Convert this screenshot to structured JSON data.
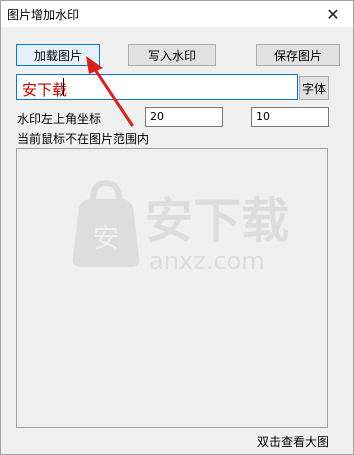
{
  "window": {
    "title": "图片增加水印",
    "close_symbol": "✕"
  },
  "toolbar": {
    "load_label": "加载图片",
    "write_label": "写入水印",
    "save_label": "保存图片"
  },
  "watermark": {
    "text": "安下载",
    "font_button": "字体"
  },
  "coords": {
    "label": "水印左上角坐标",
    "x": "20",
    "y": "10"
  },
  "status": {
    "text": "当前鼠标不在图片范围内"
  },
  "preview": {
    "hint": "双击查看大图",
    "logo_text": "安下载",
    "logo_domain": "anxz.com",
    "logo_mark_char": "安"
  },
  "annotation": {
    "arrow_color": "#d9211e"
  }
}
